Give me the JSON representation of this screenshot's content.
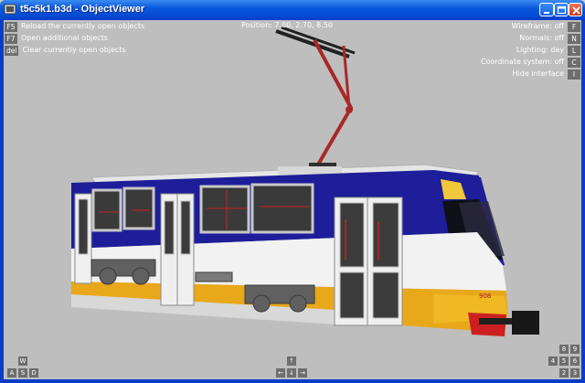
{
  "window": {
    "title": "t5c5k1.b3d - ObjectViewer",
    "buttons": [
      "minimize",
      "maximize",
      "close"
    ]
  },
  "position_readout": "Position: 7.00, 2.70, 8.50",
  "left_hints": [
    {
      "key": "F5",
      "label": "Reload the currently open objects"
    },
    {
      "key": "F7",
      "label": "Open additional objects"
    },
    {
      "key": "del",
      "label": "Clear currently open objects"
    }
  ],
  "right_hints": [
    {
      "key": "F",
      "label": "Wireframe: off"
    },
    {
      "key": "N",
      "label": "Normals: off"
    },
    {
      "key": "L",
      "label": "Lighting: day"
    },
    {
      "key": "C",
      "label": "Coordinate system: off"
    },
    {
      "key": "I",
      "label": "Hide interface"
    }
  ],
  "nav_left": {
    "top": "W",
    "bottom": [
      "A",
      "S",
      "D"
    ]
  },
  "nav_center": {
    "top": "↑",
    "bottom": [
      "←",
      "↓",
      "→"
    ]
  },
  "nav_right": {
    "top": [
      "8",
      "9"
    ],
    "mid": [
      "4",
      "5",
      "6"
    ],
    "bottom": [
      "2",
      "3"
    ]
  },
  "tram": {
    "number": "908",
    "colors": {
      "blue": "#1e1e9a",
      "white": "#f0f0f0",
      "yellow": "#e8a81a",
      "red": "#cc2020"
    }
  }
}
